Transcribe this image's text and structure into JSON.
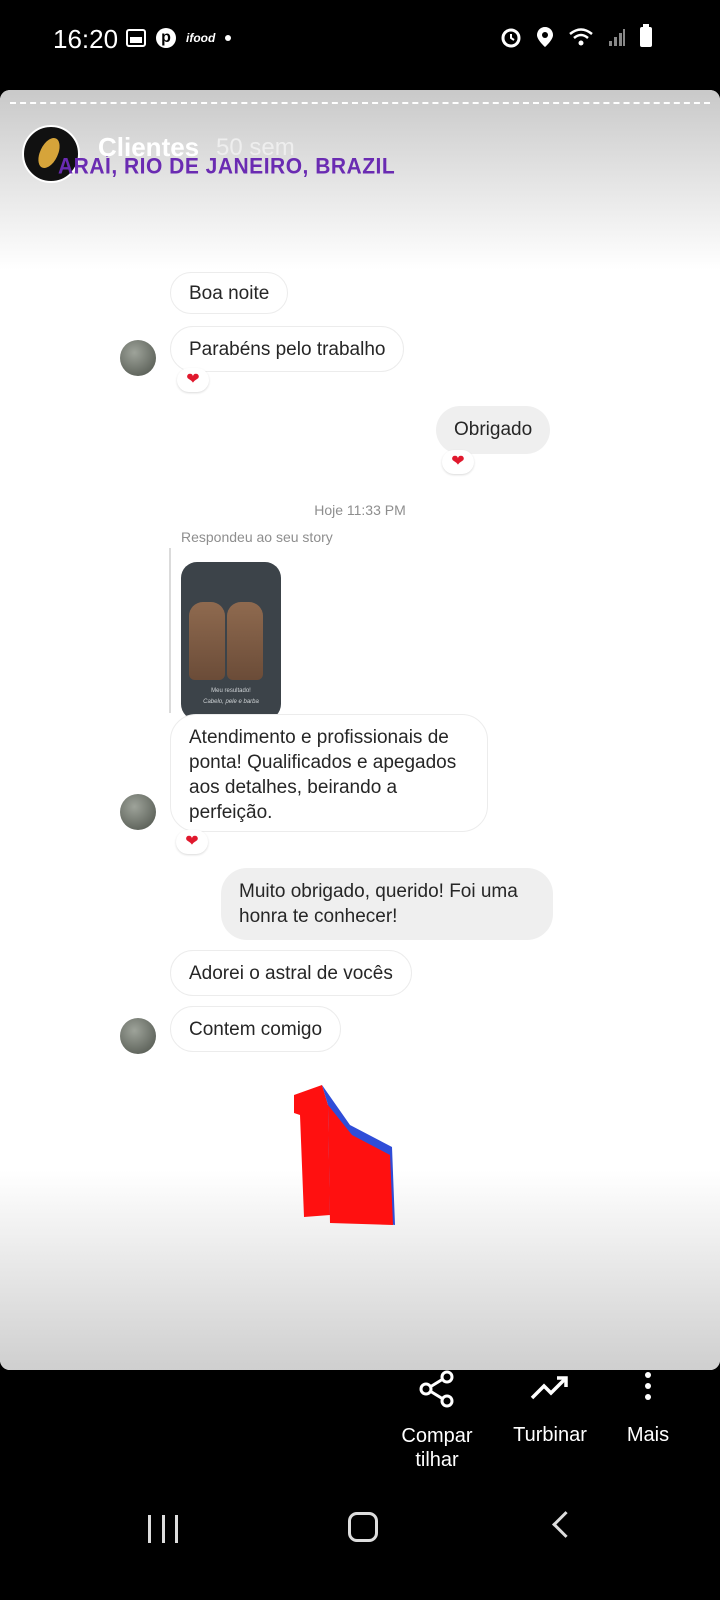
{
  "status_bar": {
    "time": "16:20",
    "left_icons": [
      "image-icon",
      "pinterest-icon",
      "ifood-icon",
      "dot-icon"
    ],
    "ifood_label": "ifood",
    "right_icons": [
      "alarm-icon",
      "location-icon",
      "wifi-icon",
      "signal-icon",
      "battery-icon"
    ]
  },
  "story": {
    "username": "Clientes",
    "time_ago": "50 sem",
    "location": "ARAÍ, RIO DE JANEIRO, BRAZIL"
  },
  "chat": {
    "messages": [
      {
        "text": "Boa noite",
        "dir": "in"
      },
      {
        "text": "Parabéns pelo trabalho",
        "dir": "in",
        "reaction": "❤"
      },
      {
        "text": "Obrigado",
        "dir": "out",
        "reaction": "❤"
      },
      {
        "text": "Atendimento e profissionais de ponta! Qualificados e apegados aos detalhes, beirando a perfeição.",
        "dir": "in",
        "reaction": "❤"
      },
      {
        "text": "Muito obrigado,  querido! Foi uma honra te conhecer!",
        "dir": "out"
      },
      {
        "text": "Adorei o astral de vocês",
        "dir": "in"
      },
      {
        "text": "Contem comigo",
        "dir": "in"
      }
    ],
    "timestamp": "Hoje 11:33 PM",
    "replied_label": "Respondeu ao seu story",
    "thumb_caption_1": "Meu resultado!",
    "thumb_caption_2": "Cabelo, pele e barba"
  },
  "actions": {
    "share": "Compar\ntilhar",
    "boost": "Turbinar",
    "more": "Mais"
  },
  "colors": {
    "location": "#6a2bb2",
    "heart": "#e0182d",
    "sticker_red": "#ff1010",
    "sticker_blue": "#2f4dd8"
  }
}
